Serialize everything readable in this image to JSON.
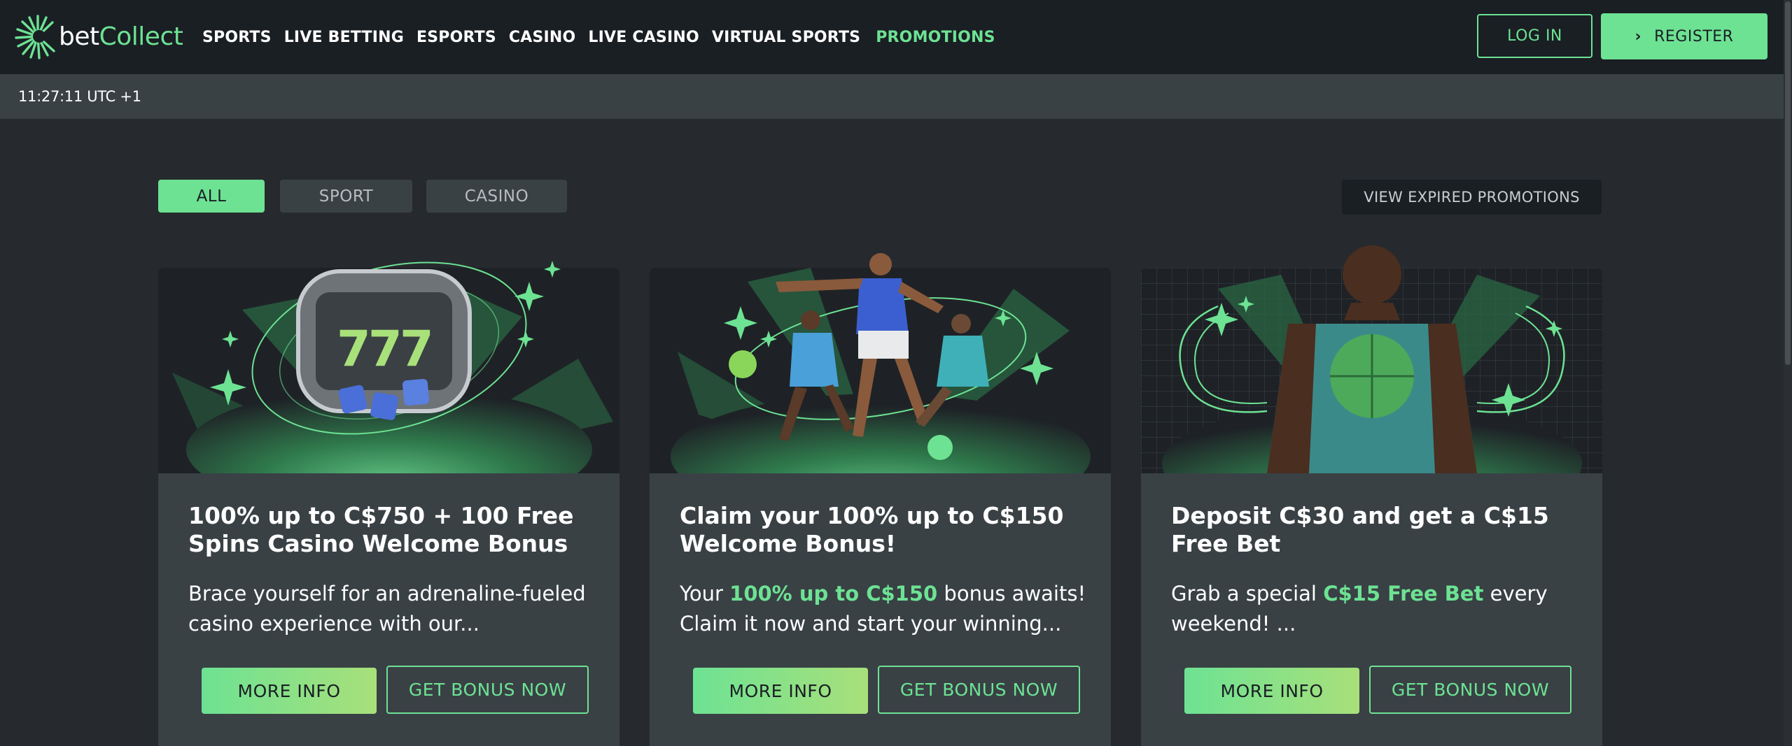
{
  "brand": {
    "name_part1": "bet",
    "name_part2": "Collect",
    "accent": "#6de293",
    "header_bg": "#1a1f24",
    "page_bg": "#262a2e",
    "card_bg": "#394145"
  },
  "nav": {
    "items": [
      "SPORTS",
      "LIVE BETTING",
      "ESPORTS",
      "CASINO",
      "LIVE CASINO",
      "VIRTUAL SPORTS",
      "PROMOTIONS"
    ],
    "active": "PROMOTIONS"
  },
  "auth": {
    "login_label": "LOG IN",
    "register_label": "REGISTER",
    "register_icon": "chevron-right-icon"
  },
  "timebar": {
    "time": "11:27:11 UTC +1"
  },
  "filters": {
    "all": "ALL",
    "sport": "SPORT",
    "casino": "CASINO",
    "selected": "ALL"
  },
  "expired_label": "VIEW EXPIRED PROMOTIONS",
  "cards": [
    {
      "image": "casino-slot-machine-illustration",
      "title": "100% up to C$750 + 100 Free Spins Casino Welcome Bonus",
      "desc_before": "Brace yourself for an adrenaline-fueled casino experience with our...",
      "desc_highlight": "",
      "desc_after": "",
      "more_label": "MORE INFO",
      "bonus_label": "GET BONUS NOW"
    },
    {
      "image": "sports-players-illustration",
      "title": "Claim your 100% up to C$150 Welcome Bonus!",
      "desc_before": "Your ",
      "desc_highlight": "100% up to C$150",
      "desc_after": " bonus awaits! Claim it now and start your winning...",
      "more_label": "MORE INFO",
      "bonus_label": "GET BONUS NOW"
    },
    {
      "image": "basketball-player-illustration",
      "title": "Deposit C$30 and get a C$15 Free Bet",
      "desc_before": "Grab a special ",
      "desc_highlight": "C$15 Free Bet",
      "desc_after": " every weekend! ...",
      "more_label": "MORE INFO",
      "bonus_label": "GET BONUS NOW"
    }
  ]
}
